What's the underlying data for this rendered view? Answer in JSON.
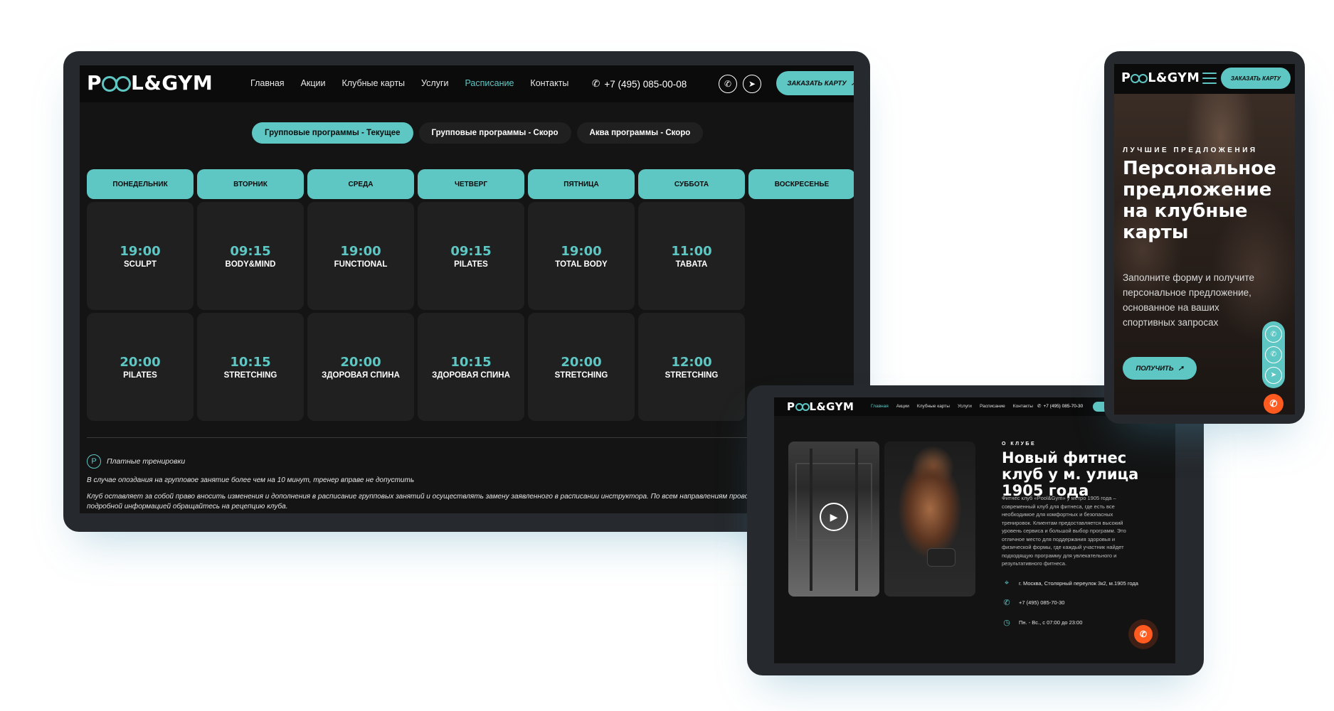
{
  "brand": {
    "logo_text_pre": "P",
    "logo_text_post": "L&GYM",
    "accent": "#5fc7c3",
    "call_color": "#ff5a1f"
  },
  "desktop": {
    "nav": [
      "Главная",
      "Акции",
      "Клубные карты",
      "Услуги",
      "Расписание",
      "Контакты"
    ],
    "active_nav": "Расписание",
    "phone": "+7 (495) 085-00-08",
    "cta": "ЗАКАЗАТЬ КАРТУ",
    "tabs": [
      "Групповые программы - Текущее",
      "Групповые программы - Скоро",
      "Аква программы - Скоро"
    ],
    "days": [
      "ПОНЕДЕЛЬНИК",
      "ВТОРНИК",
      "СРЕДА",
      "ЧЕТВЕРГ",
      "ПЯТНИЦА",
      "СУББОТА",
      "ВОСКРЕСЕНЬЕ"
    ],
    "schedule": [
      [
        {
          "time": "19:00",
          "name": "SCULPT"
        },
        {
          "time": "09:15",
          "name": "BODY&MIND"
        },
        {
          "time": "19:00",
          "name": "FUNCTIONAL"
        },
        {
          "time": "09:15",
          "name": "PILATES"
        },
        {
          "time": "19:00",
          "name": "TOTAL BODY"
        },
        {
          "time": "11:00",
          "name": "TABATA"
        }
      ],
      [
        {
          "time": "20:00",
          "name": "PILATES"
        },
        {
          "time": "10:15",
          "name": "STRETCHING"
        },
        {
          "time": "20:00",
          "name": "ЗДОРОВАЯ СПИНА"
        },
        {
          "time": "10:15",
          "name": "ЗДОРОВАЯ СПИНА"
        },
        {
          "time": "20:00",
          "name": "STRETCHING"
        },
        {
          "time": "12:00",
          "name": "STRETCHING"
        }
      ]
    ],
    "legend_icon": "P",
    "legend": "Платные тренировки",
    "note1": "В случае опоздания на групповое занятие более чем на 10 минут, тренер вправе не допустить",
    "note2": "Клуб оставляет за собой право вносить изменения и дополнения в расписание групповых занятий и осуществлять замену заявленного в расписании инструктора. По всем направлениям проводятся пе",
    "note3": "подробной информацией обращайтесь на рецепцию клуба."
  },
  "tablet": {
    "nav": [
      "Главная",
      "Акции",
      "Клубные карты",
      "Услуги",
      "Расписание",
      "Контакты"
    ],
    "phone": "+7 (495) 085-70-30",
    "about_label": "О КЛУБЕ",
    "title": "Новый фитнес клуб у м. улица 1905 года",
    "text": "Фитнес клуб «Pool&Gym» у метро 1905 года – современный клуб для фитнеса, где есть все необходимое для комфортных и безопасных тренировок. Клиентам предоставляется высокий уровень сервиса и большой выбор программ. Это отличное место для поддержания здоровья и физической формы, где каждый участник найдет подходящую программу для увлекательного и результативного фитнеса.",
    "address": "г. Москва, Столярный переулок 3к2, м.1905 года",
    "phone_row": "+7 (495) 085-70-30",
    "hours": "Пн. - Вс., с 07:00 до 23:00"
  },
  "mobile": {
    "cta": "ЗАКАЗАТЬ КАРТУ",
    "label": "ЛУЧШИЕ ПРЕДЛОЖЕНИЯ",
    "title": "Персональное предложение на клубные карты",
    "text": "Заполните форму и получите персональное предложение, основанное на ваших спортивных запросах",
    "button": "ПОЛУЧИТЬ"
  },
  "icons": [
    "phone-icon",
    "whatsapp-icon",
    "telegram-icon",
    "arrow-up-right-icon",
    "location-pin-icon",
    "clock-icon",
    "play-icon",
    "menu-icon"
  ]
}
